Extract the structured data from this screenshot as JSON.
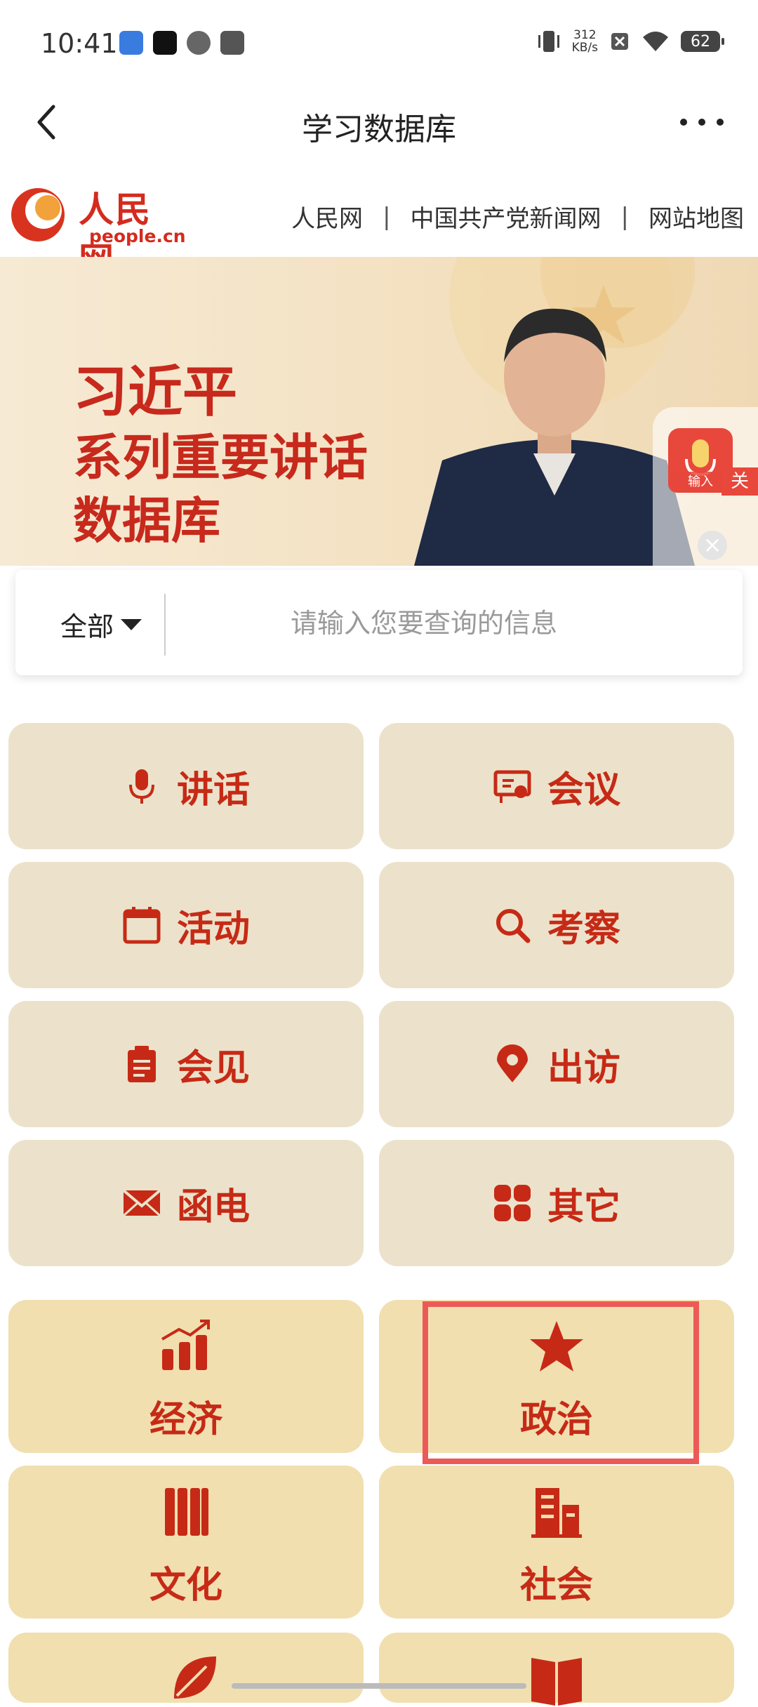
{
  "status_bar": {
    "time": "10:41",
    "net_speed_value": "312",
    "net_speed_unit": "KB/s",
    "battery": "62"
  },
  "navbar": {
    "title": "学习数据库"
  },
  "site_header": {
    "logo_text": "人民网",
    "logo_sub": "people.cn",
    "links": [
      "人民网",
      "中国共产党新闻网",
      "网站地图"
    ],
    "separator": "|"
  },
  "banner": {
    "line1": "习近平",
    "line2": "系列重要讲话",
    "line3": "数据库"
  },
  "voice_widget": {
    "input_label": "输入",
    "close_label": "关"
  },
  "search": {
    "scope": "全部",
    "placeholder": "请输入您要查询的信息"
  },
  "categories": [
    {
      "label": "讲话",
      "icon": "microphone-icon"
    },
    {
      "label": "会议",
      "icon": "meeting-icon"
    },
    {
      "label": "活动",
      "icon": "calendar-icon"
    },
    {
      "label": "考察",
      "icon": "magnifier-icon"
    },
    {
      "label": "会见",
      "icon": "clipboard-icon"
    },
    {
      "label": "出访",
      "icon": "location-pin-icon"
    },
    {
      "label": "函电",
      "icon": "envelope-icon"
    },
    {
      "label": "其它",
      "icon": "grid-icon"
    }
  ],
  "topics": [
    {
      "label": "经济",
      "icon": "chart-up-icon"
    },
    {
      "label": "政治",
      "icon": "star-icon"
    },
    {
      "label": "文化",
      "icon": "books-icon"
    },
    {
      "label": "社会",
      "icon": "building-icon"
    }
  ],
  "colors": {
    "accent_red": "#c62a16",
    "tile_beige": "#ece2cb",
    "tile_gold": "#f1dfb0",
    "highlight": "#ec5a57"
  }
}
